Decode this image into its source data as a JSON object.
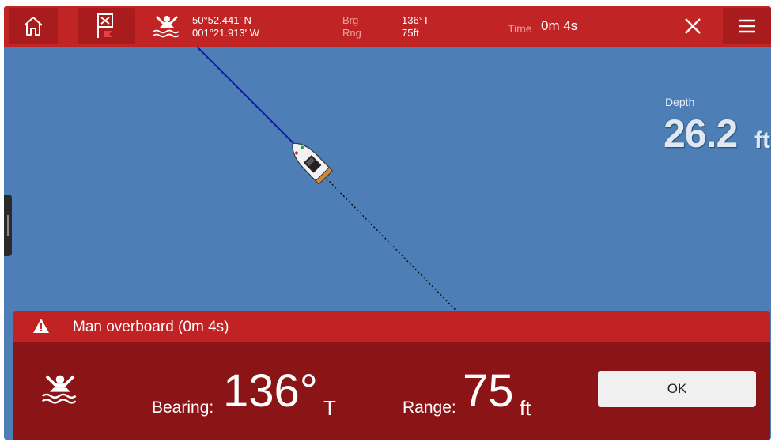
{
  "topbar": {
    "home_icon": "home-icon",
    "mob_flag_icon": "mob-flag-icon",
    "mob_icon": "man-overboard-icon",
    "latitude": "50°52.441' N",
    "longitude": "001°21.913' W",
    "brg_label": "Brg",
    "rng_label": "Rng",
    "brg_value": "136°T",
    "rng_value": "75ft",
    "time_label": "Time",
    "time_value": "0m 4s",
    "close_icon": "close-icon",
    "menu_icon": "hamburger-menu-icon"
  },
  "chart": {
    "depth_label": "Depth",
    "depth_value": "26.2",
    "depth_unit": "ft",
    "colors": {
      "water": "#4d7fb6",
      "heading_line": "#1414b4",
      "track_line": "#0a0a0a"
    }
  },
  "alarm": {
    "warning_icon": "warning-icon",
    "title": "Man overboard (0m 4s)",
    "bearing_label": "Bearing:",
    "bearing_value": "136°",
    "bearing_unit": "T",
    "range_label": "Range:",
    "range_value": "75",
    "range_unit": "ft",
    "ok_label": "OK",
    "colors": {
      "header": "#c12224",
      "body": "#8a1416"
    }
  }
}
